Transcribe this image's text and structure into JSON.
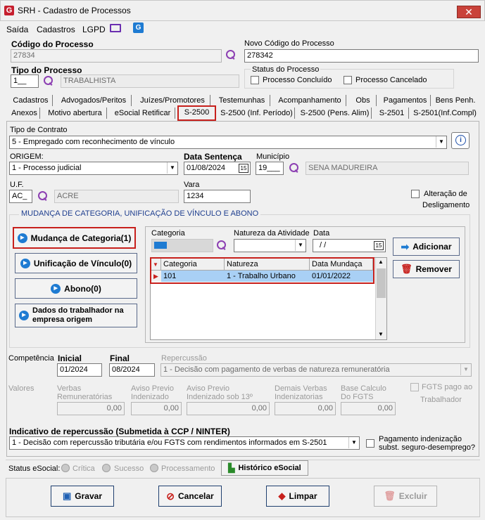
{
  "window": {
    "title": "SRH - Cadastro de Processos",
    "logo_letter": "G",
    "close_label": "✕"
  },
  "menu": [
    "Saída",
    "Cadastros",
    "LGPD"
  ],
  "header": {
    "codigo_label": "Código do Processo",
    "codigo_value": "27834",
    "novo_codigo_label": "Novo Código do Processo",
    "novo_codigo_value": "278342",
    "tipo_label": "Tipo do Processo",
    "tipo_code": "1__",
    "tipo_desc": "TRABALHISTA",
    "status_label": "Status do Processo",
    "status_concluido": "Processo Concluído",
    "status_cancelado": "Processo Cancelado"
  },
  "tabs_row1": [
    "Cadastros",
    "Advogados/Peritos",
    "Juízes/Promotores",
    "Testemunhas",
    "Acompanhamento",
    "Obs",
    "Pagamentos",
    "Bens Penh."
  ],
  "tabs_row2": [
    "Anexos",
    "Motivo abertura",
    "eSocial Retificar",
    "S-2500",
    "S-2500 (Inf. Período)",
    "S-2500 (Pens. Alim)",
    "S-2501",
    "S-2501(Inf.Compl)"
  ],
  "active_tab": "S-2500",
  "form": {
    "tipo_contrato_label": "Tipo de Contrato",
    "tipo_contrato_value": "5 - Empregado com reconhecimento de vínculo",
    "origem_label": "ORIGEM:",
    "origem_value": "1 - Processo judicial",
    "data_sentenca_label": "Data Sentença",
    "data_sentenca_value": "01/08/2024",
    "municipio_label": "Município",
    "municipio_code": "19___",
    "municipio_name": "SENA MADUREIRA",
    "uf_label": "U.F.",
    "uf_code": "AC_",
    "uf_name": "ACRE",
    "vara_label": "Vara",
    "vara_value": "1234",
    "alteracao_label_1": "Alteração de",
    "alteracao_label_2": "Desligamento",
    "calendar_glyph": "15"
  },
  "mudanca": {
    "group_title": "MUDANÇA DE CATEGORIA, UNIFICAÇÃO DE VÍNCULO E ABONO",
    "btn_mudanca": "Mudança de Categoria(1)",
    "btn_unificacao": "Unificação de Vínculo(0)",
    "btn_abono": "Abono(0)",
    "btn_dados_1": "Dados do trabalhador na",
    "btn_dados_2": "empresa origem",
    "categoria_label": "Categoria",
    "natureza_label": "Natureza da Atividade",
    "data_label": "Data",
    "data_value": "/ /",
    "btn_adicionar": "Adicionar",
    "btn_remover": "Remover",
    "grid_headers": [
      "Categoria",
      "Natureza",
      "Data Mundaça"
    ],
    "grid_row": [
      "101",
      "1 - Trabalho Urbano",
      "01/01/2022"
    ]
  },
  "competencia": {
    "label": "Competência",
    "inicial_label": "Inicial",
    "inicial_value": "01/2024",
    "final_label": "Final",
    "final_value": "08/2024",
    "repercussao_label": "Repercussão",
    "repercussao_value": "1 - Decisão com pagamento de verbas de natureza remuneratória"
  },
  "valores": {
    "label": "Valores",
    "verbas_1": "Verbas",
    "verbas_2": "Remuneratórias",
    "verbas_value": "0,00",
    "aviso_1": "Aviso Previo",
    "aviso_2": "Indenizado",
    "aviso_value": "0,00",
    "aviso13_1": "Aviso Previo",
    "aviso13_2": "Indenizado sob 13º",
    "aviso13_value": "0,00",
    "demais_1": "Demais Verbas",
    "demais_2": "Indenizatorias",
    "demais_value": "0,00",
    "base_1": "Base Calculo",
    "base_2": "Do FGTS",
    "base_value": "0,00",
    "fgts_1": "FGTS pago ao",
    "fgts_2": "Trabalhador"
  },
  "indicativo": {
    "label": "Indicativo de repercussão (Submetida à CCP / NINTER)",
    "value": "1 - Decisão com repercussão tributária e/ou FGTS com rendimentos informados em S-2501",
    "pagamento_1": "Pagamento indenização",
    "pagamento_2": "subst. seguro-desemprego?"
  },
  "status_esocial": {
    "label": "Status eSocial:",
    "critica": "Crítica",
    "sucesso": "Sucesso",
    "processamento": "Processamento",
    "historico": "Histórico eSocial"
  },
  "footer": {
    "gravar": "Gravar",
    "cancelar": "Cancelar",
    "limpar": "Limpar",
    "excluir": "Excluir"
  },
  "colors": {
    "accent_red": "#c7201c",
    "selection_blue": "#a9d0f5",
    "icon_blue": "#1e7bd2",
    "magnifier_purple": "#8c3fb2"
  }
}
